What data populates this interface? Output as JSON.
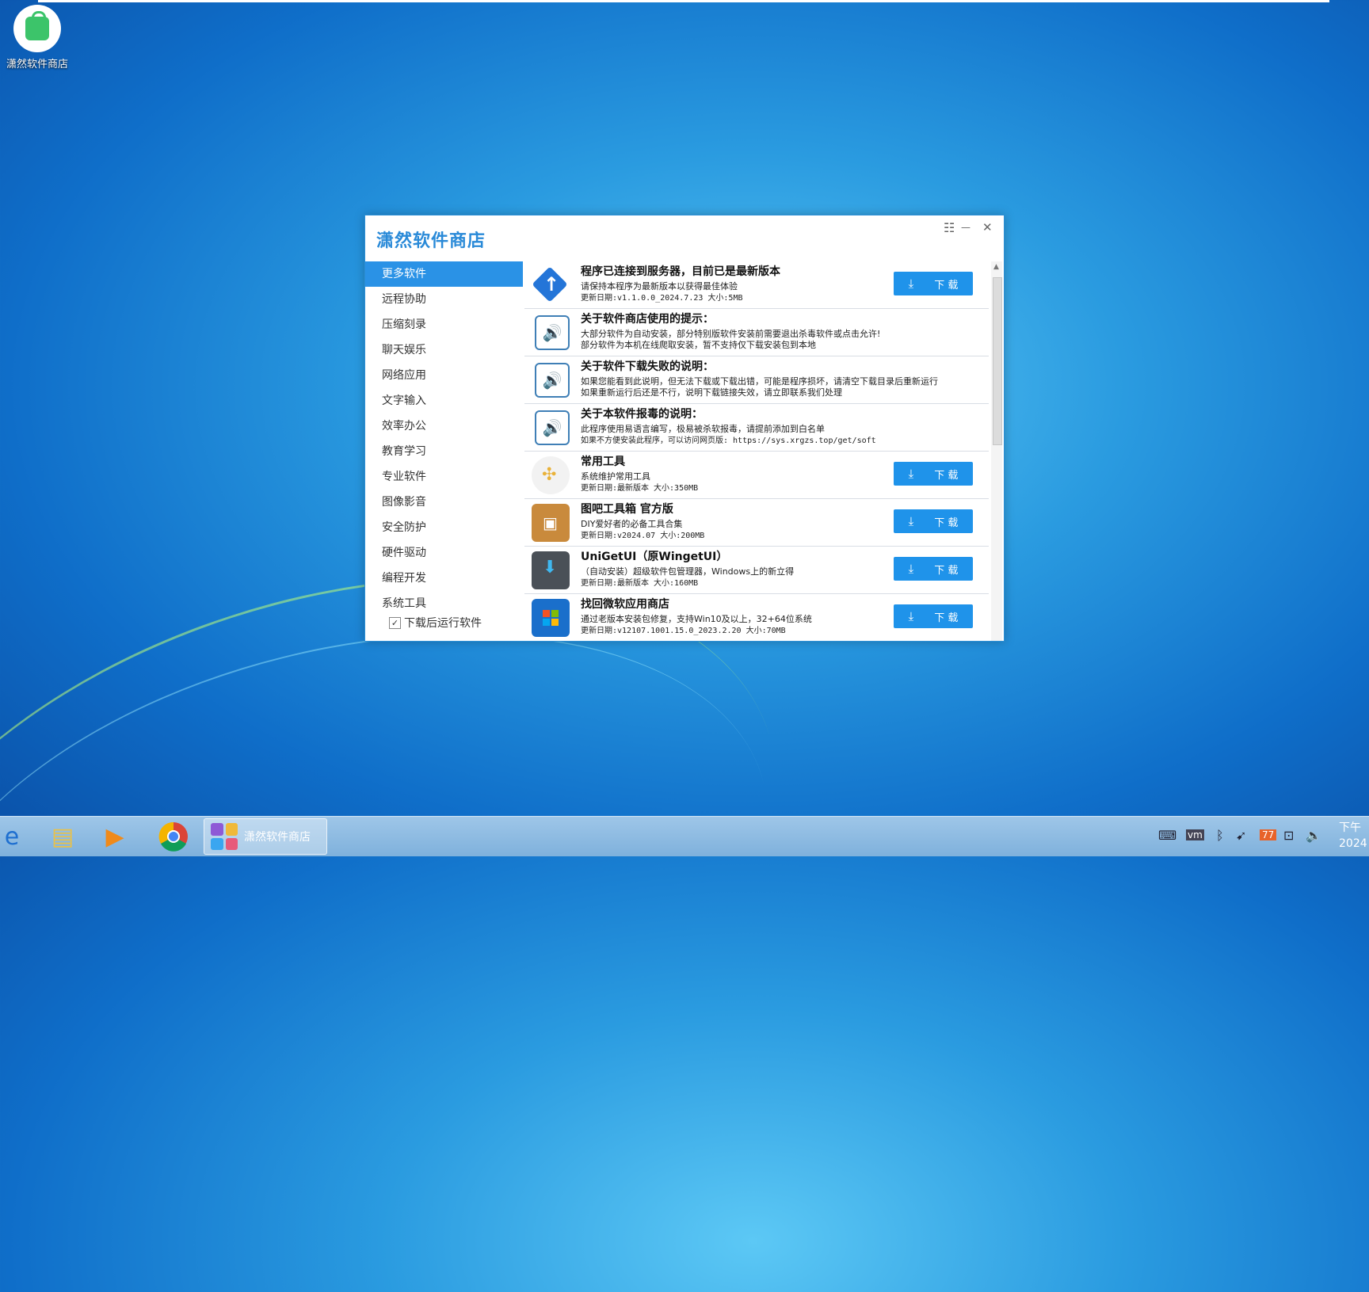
{
  "desktop": {
    "icon_label": "潇然软件商店"
  },
  "window": {
    "title": "潇然软件商店",
    "menu_icon": "☷",
    "minimize_icon": "—",
    "close_icon": "✕"
  },
  "sidebar": {
    "items": [
      {
        "label": "更多软件"
      },
      {
        "label": "远程协助"
      },
      {
        "label": "压缩刻录"
      },
      {
        "label": "聊天娱乐"
      },
      {
        "label": "网络应用"
      },
      {
        "label": "文字输入"
      },
      {
        "label": "效率办公"
      },
      {
        "label": "教育学习"
      },
      {
        "label": "专业软件"
      },
      {
        "label": "图像影音"
      },
      {
        "label": "安全防护"
      },
      {
        "label": "硬件驱动"
      },
      {
        "label": "编程开发"
      },
      {
        "label": "系统工具"
      }
    ],
    "checkbox_label": "下载后运行软件",
    "checkbox_mark": "✓"
  },
  "list": {
    "download_label": "下 载",
    "download_icon": "⤓",
    "rows": [
      {
        "title": "程序已连接到服务器，目前已是最新版本",
        "line1": "请保持本程序为最新版本以获得最佳体验",
        "line2": "更新日期:v1.1.0.0_2024.7.23  大小:5MB"
      },
      {
        "title": "关于软件商店使用的提示：",
        "line1": "大部分软件为自动安装，部分特别版软件安装前需要退出杀毒软件或点击允许!",
        "line2": "部分软件为本机在线爬取安装，暂不支持仅下载安装包到本地"
      },
      {
        "title": "关于软件下载失败的说明：",
        "line1": "如果您能看到此说明，但无法下载或下载出错，可能是程序损坏，请清空下载目录后重新运行",
        "line2": "如果重新运行后还是不行，说明下载链接失效，请立即联系我们处理"
      },
      {
        "title": "关于本软件报毒的说明：",
        "line1": "此程序使用易语言编写，极易被杀软报毒，请提前添加到白名单",
        "line2": "如果不方便安装此程序，可以访问网页版: https://sys.xrgzs.top/get/soft"
      },
      {
        "title": "常用工具",
        "line1": "系统维护常用工具",
        "line2": "更新日期:最新版本    大小:350MB"
      },
      {
        "title": "图吧工具箱 官方版",
        "line1": "DIY爱好者的必备工具合集",
        "line2": "更新日期:v2024.07    大小:200MB"
      },
      {
        "title": "UniGetUI（原WingetUI）",
        "line1": "（自动安装）超级软件包管理器，Windows上的新立得",
        "line2": "更新日期:最新版本    大小:160MB"
      },
      {
        "title": "找回微软应用商店",
        "line1": "通过老版本安装包修复，支持Win10及以上，32+64位系统",
        "line2": "更新日期:v12107.1001.15.0_2023.2.20  大小:70MB"
      }
    ]
  },
  "taskbar": {
    "task_label": "潇然软件商店",
    "tray_badge": "77",
    "clock_line1": "下午",
    "clock_line2": "2024"
  }
}
